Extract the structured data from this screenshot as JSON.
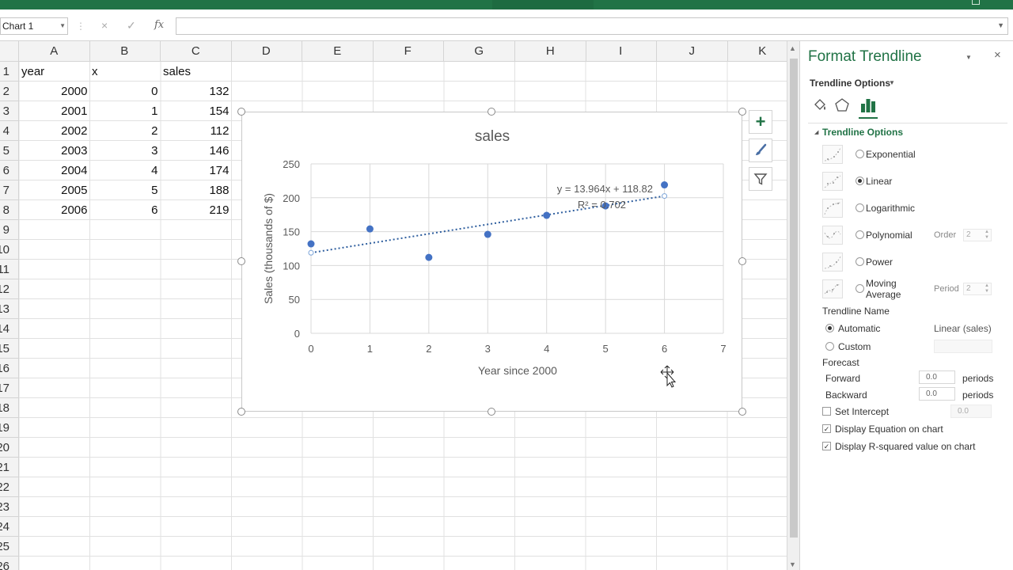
{
  "formula_bar": {
    "name_box": "Chart 1",
    "fx_label": "fx",
    "cancel_icon": "×",
    "enter_icon": "✓"
  },
  "columns": [
    "A",
    "B",
    "C",
    "D",
    "E",
    "F",
    "G",
    "H",
    "I",
    "J",
    "K"
  ],
  "rows": [
    "1",
    "2",
    "3",
    "4",
    "5",
    "6",
    "7",
    "8",
    "9",
    "10",
    "11",
    "12",
    "13",
    "14",
    "15",
    "16",
    "17",
    "18",
    "19",
    "20",
    "21",
    "22",
    "23",
    "24",
    "25",
    "26"
  ],
  "sheet": {
    "headers": {
      "year": "year",
      "x": "x",
      "sales": "sales"
    },
    "data": [
      {
        "year": "2000",
        "x": "0",
        "sales": "132"
      },
      {
        "year": "2001",
        "x": "1",
        "sales": "154"
      },
      {
        "year": "2002",
        "x": "2",
        "sales": "112"
      },
      {
        "year": "2003",
        "x": "3",
        "sales": "146"
      },
      {
        "year": "2004",
        "x": "4",
        "sales": "174"
      },
      {
        "year": "2005",
        "x": "5",
        "sales": "188"
      },
      {
        "year": "2006",
        "x": "6",
        "sales": "219"
      }
    ]
  },
  "chart_data": {
    "type": "scatter",
    "title": "sales",
    "xlabel": "Year since 2000",
    "ylabel": "Sales (thousands of $)",
    "xlim": [
      0,
      7
    ],
    "ylim": [
      0,
      250
    ],
    "xticks": [
      "0",
      "1",
      "2",
      "3",
      "4",
      "5",
      "6",
      "7"
    ],
    "yticks": [
      "0",
      "50",
      "100",
      "150",
      "200",
      "250"
    ],
    "grid": true,
    "legend": "none",
    "series": [
      {
        "x": [
          0,
          1,
          2,
          3,
          4,
          5,
          6
        ],
        "y": [
          132,
          154,
          112,
          146,
          174,
          188,
          219
        ],
        "color": "#4472c4"
      }
    ],
    "trendline": {
      "type": "linear",
      "slope": 13.964,
      "intercept": 118.82,
      "equation": "y = 13.964x + 118.82",
      "r_squared": "R² = 0.702",
      "color": "#2e5e9e",
      "style": "dotted"
    }
  },
  "chart_buttons": {
    "add_icon": "+",
    "style_icon": "brush",
    "filter_icon": "filter"
  },
  "pane": {
    "title": "Format Trendline",
    "close_icon": "×",
    "subtitle": "Trendline Options",
    "section": "Trendline Options",
    "accent": "#217346",
    "types": [
      {
        "label": "Exponential",
        "selected": false
      },
      {
        "label": "Linear",
        "selected": true
      },
      {
        "label": "Logarithmic",
        "selected": false
      },
      {
        "label": "Polynomial",
        "selected": false,
        "sub_label": "Order",
        "sub_value": "2"
      },
      {
        "label": "Power",
        "selected": false
      },
      {
        "label_line1": "Moving",
        "label_line2": "Average",
        "selected": false,
        "sub_label": "Period",
        "sub_value": "2"
      }
    ],
    "trendline_name": {
      "heading": "Trendline Name",
      "automatic": "Automatic",
      "automatic_value": "Linear (sales)",
      "custom": "Custom",
      "selected": "automatic"
    },
    "forecast": {
      "heading": "Forecast",
      "forward": "Forward",
      "forward_value": "0.0",
      "backward": "Backward",
      "backward_value": "0.0",
      "unit": "periods"
    },
    "set_intercept": {
      "label": "Set Intercept",
      "value": "0.0",
      "checked": false
    },
    "display_equation": {
      "label": "Display Equation on chart",
      "checked": true
    },
    "display_r_squared": {
      "label": "Display R-squared value on chart",
      "checked": true
    }
  }
}
